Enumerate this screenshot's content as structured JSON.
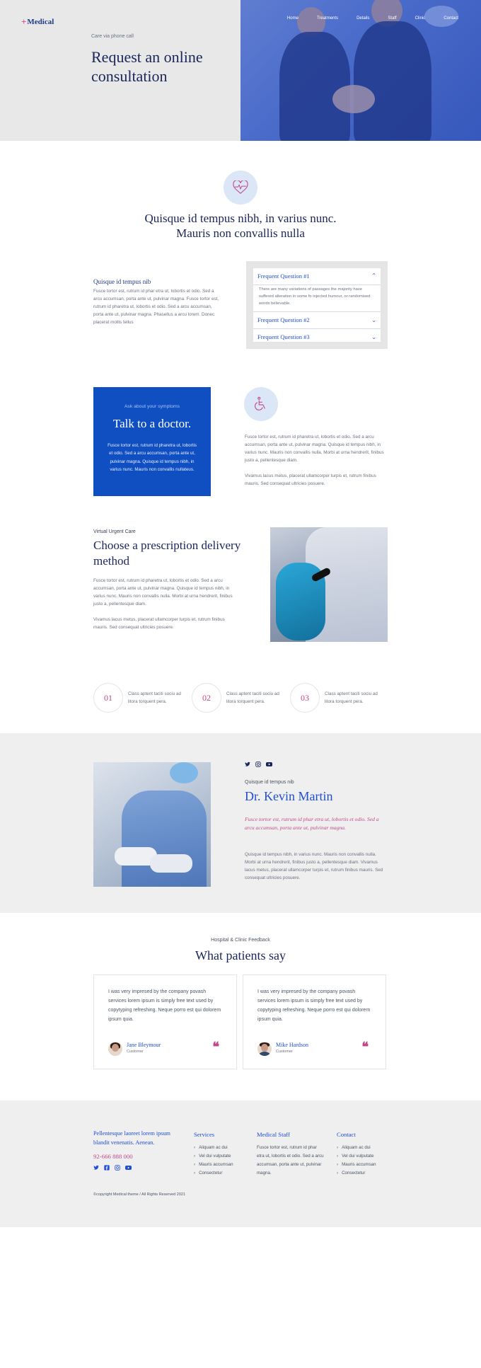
{
  "brand": {
    "plus": "+",
    "name": "Medical"
  },
  "nav": [
    "Home",
    "Treatments",
    "Details",
    "Staff",
    "Clinic",
    "Contact"
  ],
  "hero": {
    "kicker": "Care via phone call",
    "title": "Request an online consultation"
  },
  "intro": {
    "icon": "heart-pulse-icon",
    "title": "Quisque id tempus nibh, in varius nunc. Mauris non convallis nulla",
    "subtitle": "Quisque id tempus nib",
    "body": "Fusce tortor est, rutrum id phar etra ut, lobortis et odio. Sed a arcu accumsan, porta ante ut, pulvinar magna. Fusce tortor est, rutrum id pharetra ut, lobortis et odio. Sed a arcu accumsan, porta ante ut, pulvinar magna. Phasellus a arcu lorem. Donec placerat mollis tellus"
  },
  "faq": [
    {
      "q": "Frequent Question #1",
      "a": "There are many variations of passages the majority have suffered alteration in some fo injected humour, or randomised words believable.",
      "open": true
    },
    {
      "q": "Frequent Question #2",
      "open": false
    },
    {
      "q": "Frequent Question #3",
      "open": false
    }
  ],
  "doctor_box": {
    "kicker": "Ask about your symptoms",
    "title": "Talk to a doctor.",
    "body": "Fusce tortor est, rutrum id pharetra ut, lobortis et odio. Sed a arcu accumsan, porta ante ut, pulvinar magna. Quisque id tempus nibh, in varius nunc. Mauris non convallis nullateus."
  },
  "symptoms": {
    "icon": "wheelchair-icon",
    "p1": "Fusce tortor est, rutrum id pharetra ut, lobortis et odio. Sed a arcu accumsan, porta ante ut, pulvinar magna. Quisque id tempus nibh, in varius nunc. Mauris non convallis nulla. Morbi at urna hendrerit, finibus justo a, pellentesque diam.",
    "p2": "Vivamus lacus metus, placerat ullamcorper turpis et, rutrum finibus mauris. Sed consequat ultricies posuere."
  },
  "prescription": {
    "kicker": "Virtual Urgent Care",
    "title": "Choose a prescription delivery method",
    "p1": "Fusce tortor est, rutrum id pharetra ut, lobortis et odio. Sed a arcu accumsan, porta ante ut, pulvinar magna. Quisque id tempus nibh, in varius nunc. Mauris non convallis nulla. Morbi at urna hendrerit, finibus justo a, pellentesque diam.",
    "p2": "Vivamus lacus metus, placerat ullamcorper turpis et, rutrum finibus mauris. Sed consequat ultricies posuere."
  },
  "steps": [
    {
      "num": "01",
      "text": "Class aptent taciti sociu ad litora torquent pera."
    },
    {
      "num": "02",
      "text": "Class aptent taciti sociu ad litora torquent pera."
    },
    {
      "num": "03",
      "text": "Class aptent taciti sociu ad litora torquent pera."
    }
  ],
  "doctor": {
    "social_icons": [
      "twitter-icon",
      "instagram-icon",
      "youtube-icon"
    ],
    "kicker": "Quisque id tempus nib",
    "name": "Dr. Kevin Martin",
    "quote": "Fusce tortor est, rutrum id phar etra ut, lobortis et odio. Sed a arcu accumsan, porta ante ut, pulvinar magna.",
    "body": "Quisque id tempus nibh, in varius nunc. Mauris non convallis nulla. Morbi at urna hendrerit, finibus justo a, pellentesque diam. Vivamus lacus metus, placerat ullamcorper turpis et, rutrum finibus mauris. Sed consequat ultricies posuere."
  },
  "testimonials": {
    "kicker": "Hospital & Clinic Feedback",
    "title": "What patients say",
    "items": [
      {
        "quote": "I was very impresed by the company povash services lorem ipsum is simply free text used by copytyping refreshing. Neque porro est qui dolorem ipsum quia.",
        "name": "Jane Bleymour",
        "role": "Customer"
      },
      {
        "quote": "I was very impresed by the company povash services lorem ipsum is simply free text used by copytyping refreshing. Neque porro est qui dolorem ipsum quia.",
        "name": "Mike Hardson",
        "role": "Customer"
      }
    ],
    "quote_glyph": "❝"
  },
  "footer": {
    "tagline": "Pellentesque laoreet lorem ipsum blandit venenatis. Aenean.",
    "phone": "92-666 888 000",
    "social_icons": [
      "twitter-icon",
      "facebook-icon",
      "instagram-icon",
      "youtube-icon"
    ],
    "services": {
      "title": "Services",
      "items": [
        "Aliquam ac dui",
        "Vel dui vulputate",
        "Mauris accumsan",
        "Consectetur"
      ]
    },
    "staff": {
      "title": "Medical Staff",
      "text": "Fusce tortor est, rutrum id phar etra ut, lobortis et odio. Sed a arcu accumsan, porta ante ut, pulvinar magna."
    },
    "contact": {
      "title": "Contact",
      "items": [
        "Aliquam ac dui",
        "Vel dui vulputate",
        "Mauris accumsan",
        "Consectetur"
      ]
    },
    "copyright": "©copyright Medical theme / All Rights Reserved 2021"
  },
  "colors": {
    "navy": "#1a2559",
    "blue": "#1d4ed8",
    "box_blue": "#0f4fc2",
    "pink": "#c0498a",
    "gray_bg": "#efefef"
  }
}
